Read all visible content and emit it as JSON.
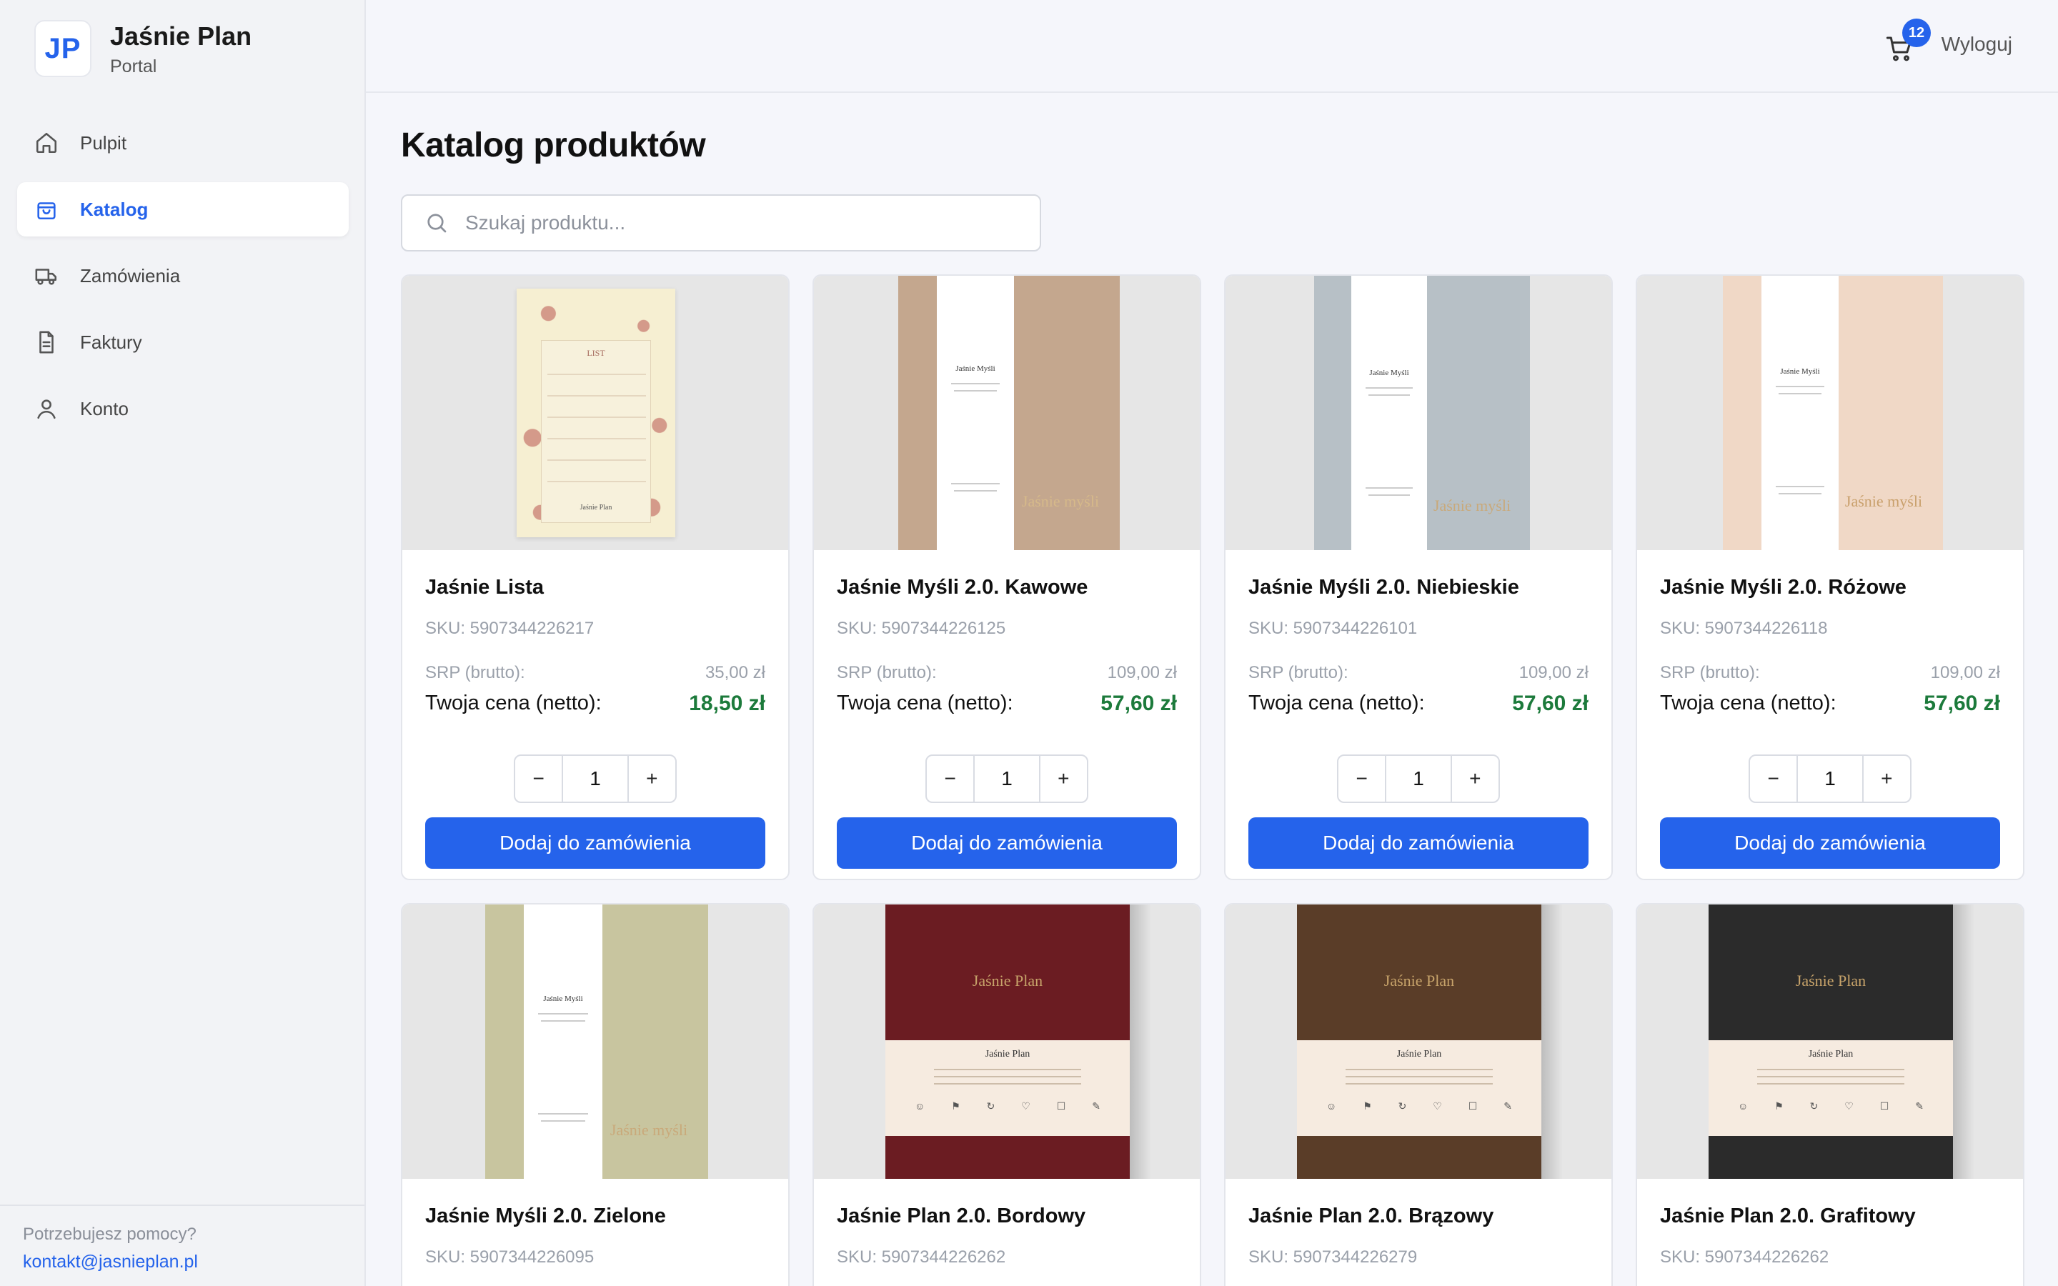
{
  "brand": {
    "initials": "JP",
    "name": "Jaśnie Plan",
    "sub": "Portal"
  },
  "nav": [
    {
      "label": "Pulpit",
      "icon": "home-icon",
      "active": false
    },
    {
      "label": "Katalog",
      "icon": "shopping-bag-icon",
      "active": true
    },
    {
      "label": "Zamówienia",
      "icon": "truck-icon",
      "active": false
    },
    {
      "label": "Faktury",
      "icon": "document-icon",
      "active": false
    },
    {
      "label": "Konto",
      "icon": "user-icon",
      "active": false
    }
  ],
  "help": {
    "label": "Potrzebujesz pomocy?",
    "email": "kontakt@jasnieplan.pl"
  },
  "topbar": {
    "cart_count": "12",
    "logout": "Wyloguj"
  },
  "page": {
    "title": "Katalog produktów"
  },
  "search": {
    "placeholder": "Szukaj produktu..."
  },
  "labels": {
    "srp": "SRP (brutto):",
    "your_price": "Twoja cena (netto):",
    "add": "Dodaj do zamówienia",
    "minus": "−",
    "plus": "+"
  },
  "products": [
    {
      "name": "Jaśnie Lista",
      "sku": "SKU: 5907344226217",
      "srp": "35,00 zł",
      "price": "18,50 zł",
      "qty": "1",
      "art": "floral"
    },
    {
      "name": "Jaśnie Myśli 2.0. Kawowe",
      "sku": "SKU: 5907344226125",
      "srp": "109,00 zł",
      "price": "57,60 zł",
      "qty": "1",
      "art": "band",
      "color": "#c4a78e"
    },
    {
      "name": "Jaśnie Myśli 2.0. Niebieskie",
      "sku": "SKU: 5907344226101",
      "srp": "109,00 zł",
      "price": "57,60 zł",
      "qty": "1",
      "art": "band",
      "color": "#b7c0c6"
    },
    {
      "name": "Jaśnie Myśli 2.0. Różowe",
      "sku": "SKU: 5907344226118",
      "srp": "109,00 zł",
      "price": "57,60 zł",
      "qty": "1",
      "art": "band",
      "color": "#f0d8c6"
    },
    {
      "name": "Jaśnie Myśli 2.0. Zielone",
      "sku": "SKU: 5907344226095",
      "art": "band",
      "color": "#c8c59f"
    },
    {
      "name": "Jaśnie Plan 2.0. Bordowy",
      "sku": "SKU: 5907344226262",
      "art": "planner",
      "color": "#6b1c22"
    },
    {
      "name": "Jaśnie Plan 2.0. Brązowy",
      "sku": "SKU: 5907344226279",
      "art": "planner",
      "color": "#5a3d28"
    },
    {
      "name": "Jaśnie Plan 2.0. Grafitowy",
      "sku": "SKU: 5907344226262",
      "art": "planner",
      "color": "#2b2b2b"
    }
  ],
  "art_text": {
    "list_title": "LIST",
    "list_brand": "Jaśnie Plan",
    "myśli_label": "Jaśnie Myśli",
    "myśli_script": "Jaśnie myśli",
    "plan_cover": "Jaśnie Plan",
    "plan_sleeve": "Jaśnie Plan"
  },
  "colors": {
    "accent": "#2563eb",
    "price": "#1c7a3b"
  }
}
